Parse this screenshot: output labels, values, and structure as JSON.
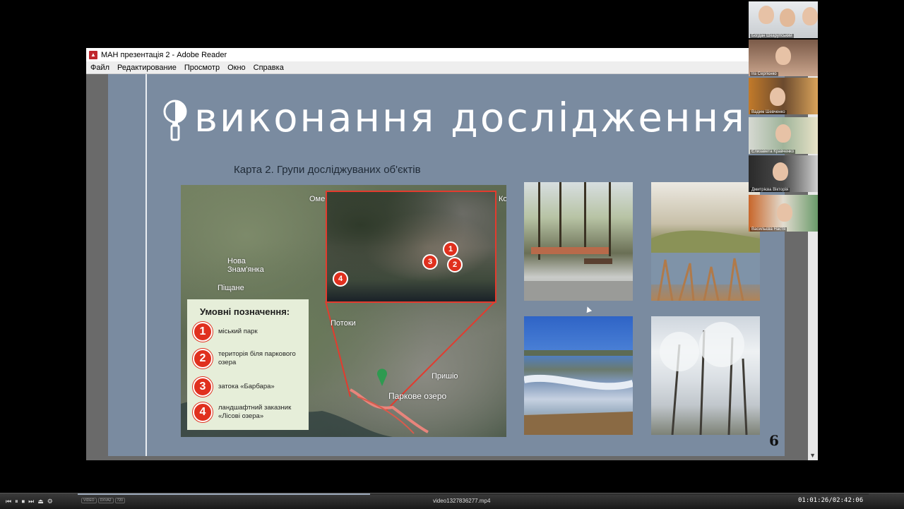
{
  "window": {
    "title": "МАН презентація 2 - Adobe Reader",
    "menu": [
      "Файл",
      "Редактирование",
      "Просмотр",
      "Окно",
      "Справка"
    ]
  },
  "slide": {
    "title": "виконання дослідження",
    "map_caption": "Карта 2. Групи досліджуваних об'єктів",
    "page_number": "6",
    "map_places": [
      "Оме",
      "Ко",
      "Нова\nЗнам'янка",
      "Піщане",
      "Потоки",
      "Пришіо",
      "Паркове озеро"
    ],
    "inset_markers": [
      "1",
      "2",
      "3",
      "4"
    ],
    "legend": {
      "title": "Умовні позначення:",
      "items": [
        {
          "num": "1",
          "label": "міський парк"
        },
        {
          "num": "2",
          "label": "територія біля паркового озера"
        },
        {
          "num": "3",
          "label": "затока «Барбара»"
        },
        {
          "num": "4",
          "label": "ландшафтний заказник «Лісові озера»"
        }
      ]
    }
  },
  "participants": [
    "Богдан Шкарупський",
    "Ira Сергієнко",
    "Вадим Шевченко",
    "Єлизавета Кравченко",
    "Дмитрієва Вікторія",
    "Васильєва Настя"
  ],
  "player": {
    "filename": "video1327836277.mp4",
    "time": "01:01:26/02:42:06",
    "progress": 0.37,
    "badges": [
      "VIDEO",
      "DXVA2",
      "720"
    ]
  }
}
